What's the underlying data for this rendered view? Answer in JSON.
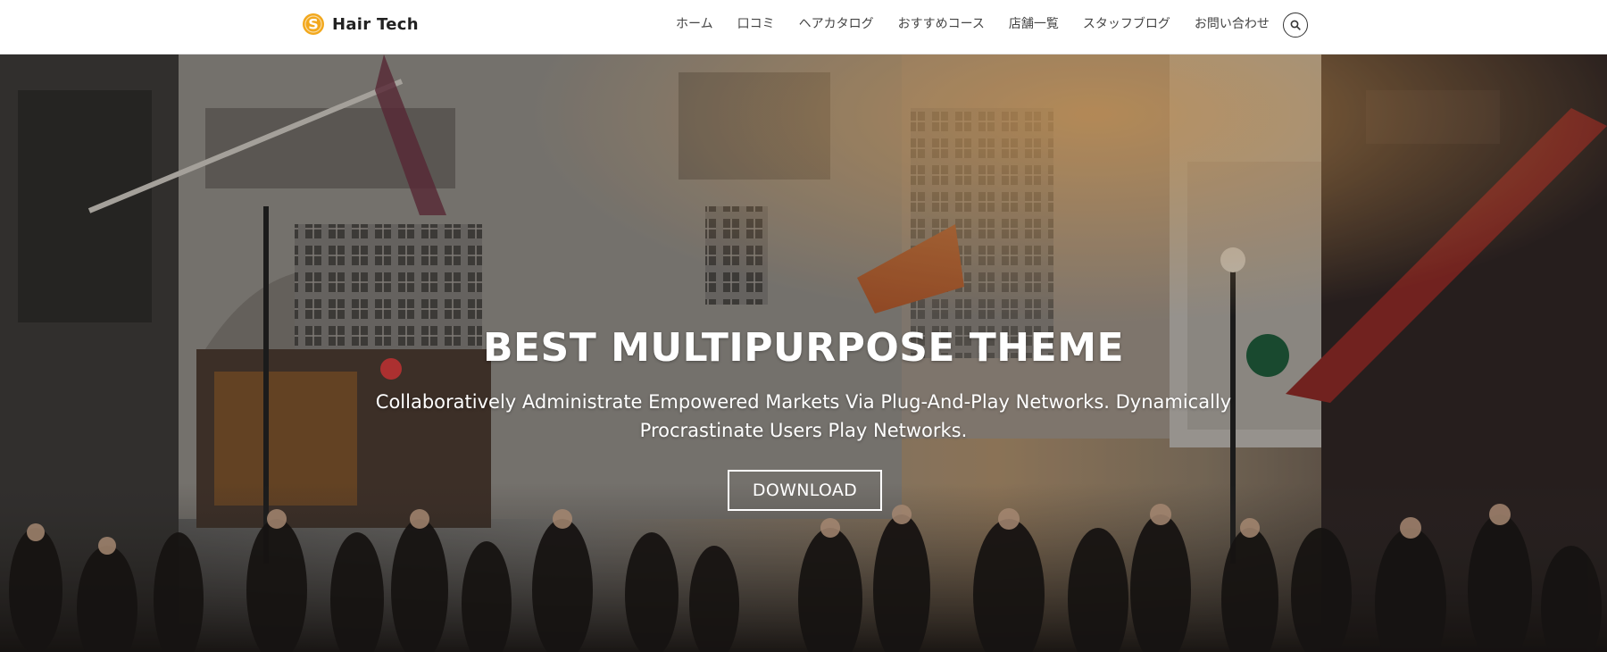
{
  "brand": {
    "name": "Hair Tech",
    "logo_icon": "dollar-coin-logo-icon",
    "accent_color": "#F2A81D"
  },
  "nav": {
    "items": [
      {
        "label": "ホーム"
      },
      {
        "label": "口コミ"
      },
      {
        "label": "ヘアカタログ"
      },
      {
        "label": "おすすめコース"
      },
      {
        "label": "店舗一覧"
      },
      {
        "label": "スタッフブログ"
      },
      {
        "label": "お問い合わせ"
      }
    ],
    "search_icon": "search-icon"
  },
  "hero": {
    "title": "BEST MULTIPURPOSE THEME",
    "subtitle": "Collaboratively Administrate Empowered Markets Via Plug-And-Play Networks. Dynamically Procrastinate Users Play Networks.",
    "button_label": "DOWNLOAD",
    "background": "city-street-crowd-photo"
  }
}
